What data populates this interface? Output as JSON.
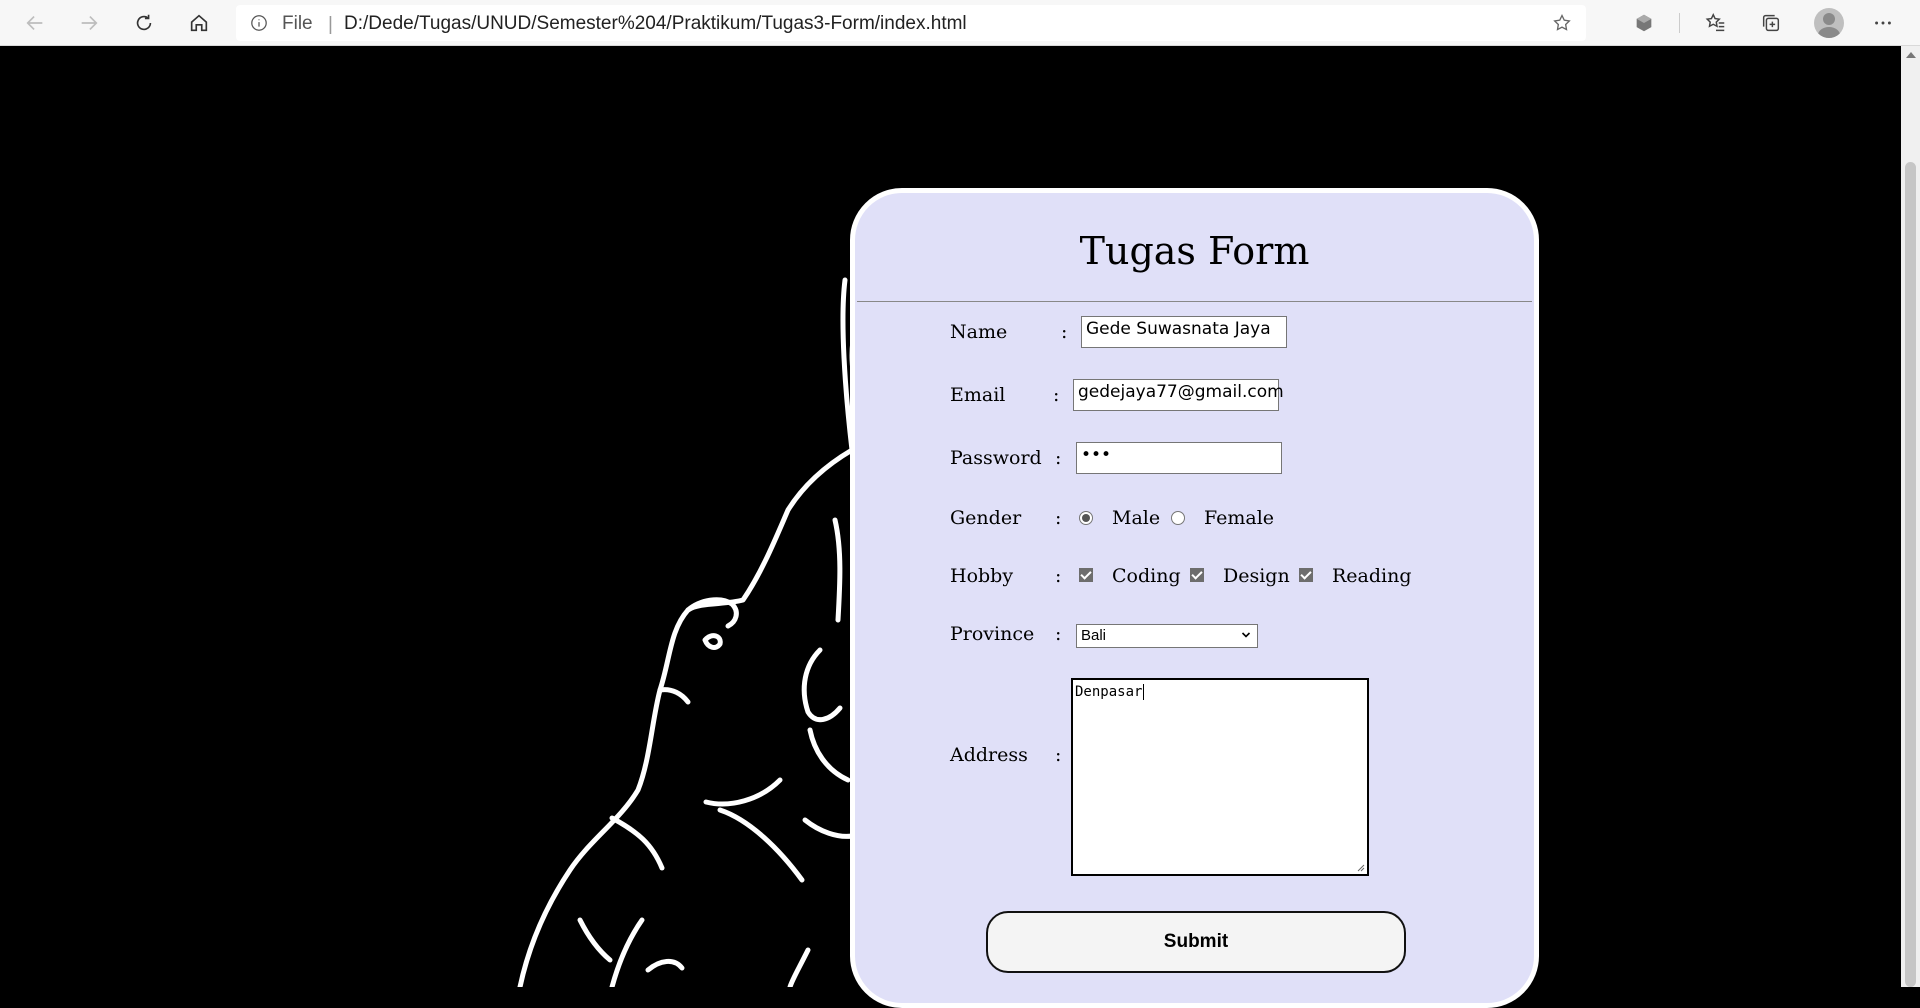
{
  "browser": {
    "file_label": "File",
    "separator": "|",
    "url": "D:/Dede/Tugas/UNUD/Semester%204/Praktikum/Tugas3-Form/index.html"
  },
  "form": {
    "title": "Tugas Form",
    "colon": ":",
    "name": {
      "label": "Name",
      "value": "Gede Suwasnata Jaya"
    },
    "email": {
      "label": "Email",
      "value": "gedejaya77@gmail.com"
    },
    "password": {
      "label": "Password",
      "masked": "•••"
    },
    "gender": {
      "label": "Gender",
      "options": [
        "Male",
        "Female"
      ],
      "selected": "Male"
    },
    "hobby": {
      "label": "Hobby",
      "options": [
        "Coding",
        "Design",
        "Reading"
      ],
      "checked": [
        "Coding",
        "Design",
        "Reading"
      ]
    },
    "province": {
      "label": "Province",
      "selected": "Bali"
    },
    "address": {
      "label": "Address",
      "value": "Denpasar"
    },
    "submit_label": "Submit"
  }
}
